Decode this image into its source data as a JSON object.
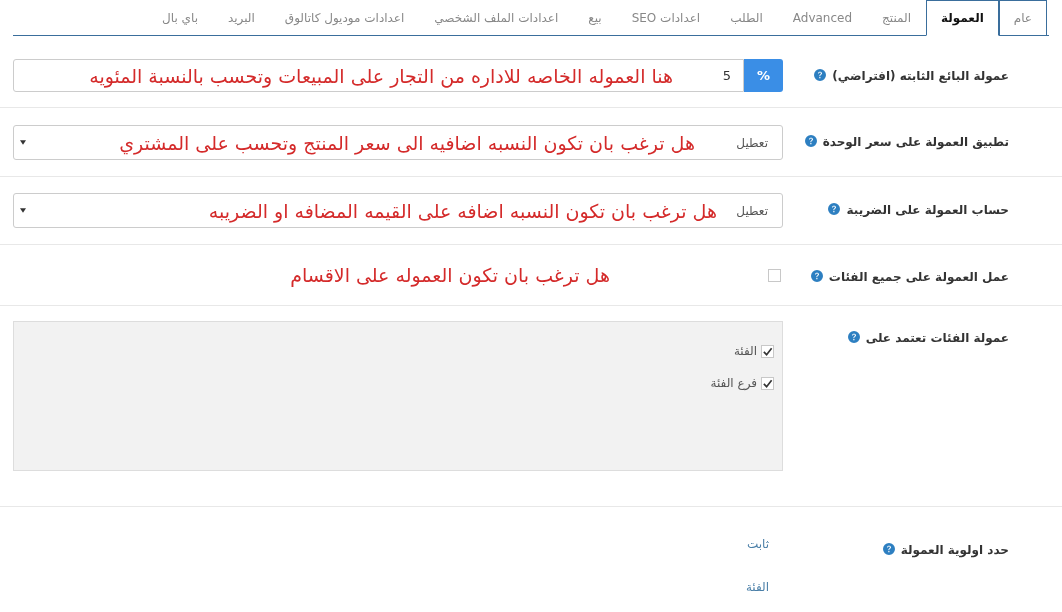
{
  "tabs": [
    {
      "label": "عام",
      "selected": false
    },
    {
      "label": "العمولة",
      "selected": true
    },
    {
      "label": "المنتج",
      "selected": false
    },
    {
      "label": "Advanced",
      "selected": false
    },
    {
      "label": "الطلب",
      "selected": false
    },
    {
      "label": "اعدادات SEO",
      "selected": false
    },
    {
      "label": "بيع",
      "selected": false
    },
    {
      "label": "اعدادات الملف الشخصي",
      "selected": false
    },
    {
      "label": "اعدادات موديول كاتالوق",
      "selected": false
    },
    {
      "label": "البريد",
      "selected": false
    },
    {
      "label": "باي بال",
      "selected": false
    }
  ],
  "rows": [
    {
      "kind": "percent",
      "label": "عمولة البائع الثابته (افتراضي)",
      "addon": "%",
      "value": "5",
      "annotation": "هنا العموله الخاصه للاداره من التجار على المبيعات وتحسب بالنسبة المئويه"
    },
    {
      "kind": "select",
      "label": "تطبيق العمولة على سعر الوحدة",
      "value": "تعطيل",
      "annotation": "هل ترغب بان تكون النسبه اضافيه الى سعر المنتج وتحسب على المشتري"
    },
    {
      "kind": "select",
      "label": "حساب العمولة على الضريبة",
      "value": "تعطيل",
      "annotation": "هل ترغب بان تكون النسبه اضافه على القيمه المضافه او الضريبه"
    },
    {
      "kind": "checkbox",
      "label": "عمل العمولة على جميع الفئات",
      "checked": false,
      "annotation": "هل ترغب بان تكون العموله على الاقسام"
    },
    {
      "kind": "checklist",
      "label": "عمولة الفئات تعتمد على",
      "items": [
        {
          "label": "الفئة",
          "checked": true
        },
        {
          "label": "فرع الفئة",
          "checked": true
        }
      ]
    },
    {
      "kind": "priority",
      "label": "حدد اولوية العمولة",
      "items": [
        "ثابت",
        "الفئة"
      ]
    }
  ]
}
